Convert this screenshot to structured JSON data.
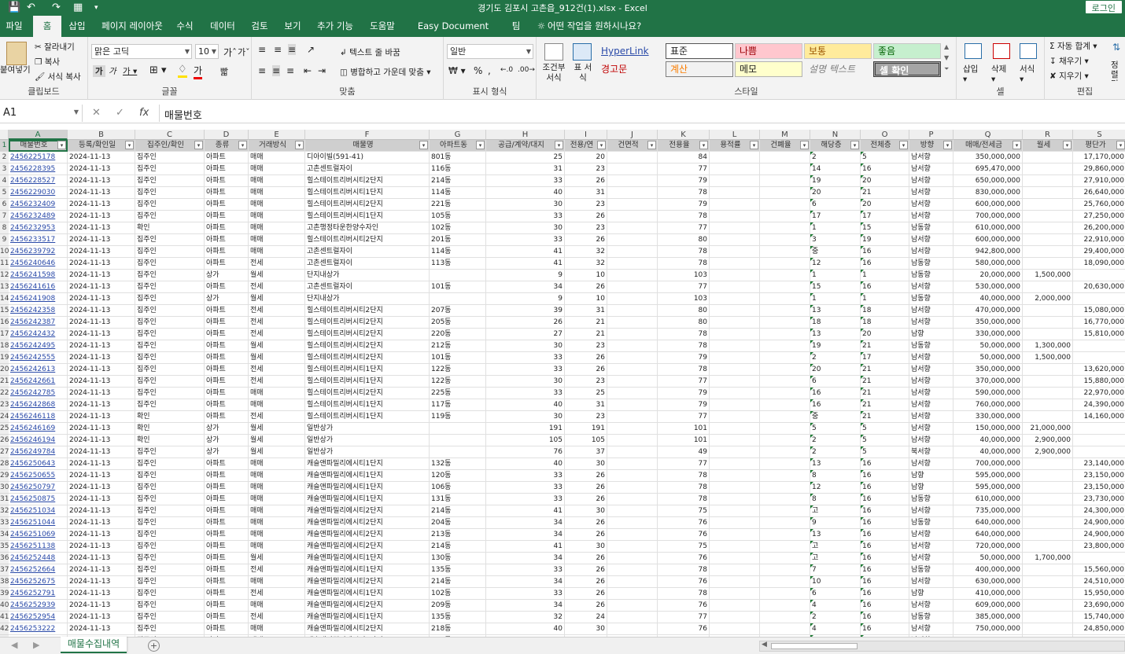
{
  "window": {
    "title": "경기도 김포시 고촌읍_912건(1).xlsx  -  Excel",
    "login": "로그인"
  },
  "tabs": [
    "파일",
    "홈",
    "삽입",
    "페이지 레이아웃",
    "수식",
    "데이터",
    "검토",
    "보기",
    "추가 기능",
    "도움말",
    "Easy Document Creator",
    "팀",
    "어떤 작업을 원하시나요?"
  ],
  "ribbon": {
    "clipboard": {
      "paste": "붙여넣기",
      "cut": "잘라내기",
      "copy": "복사",
      "format_painter": "서식 복사",
      "label": "클립보드"
    },
    "font": {
      "name": "맑은 고딕",
      "size": "10",
      "label": "글꼴"
    },
    "align": {
      "wrap": "텍스트 줄 바꿈",
      "merge": "병합하고 가운데 맞춤",
      "label": "맞춤"
    },
    "number": {
      "format": "일반",
      "label": "표시 형식"
    },
    "styles": {
      "cond": "조건부 서식",
      "table": "표 서식",
      "cells": [
        "HyperLink",
        "표준",
        "나쁨",
        "보통",
        "좋음",
        "경고문",
        "계산",
        "메모",
        "설명 텍스트",
        "셀 확인"
      ],
      "label": "스타일"
    },
    "cells": {
      "insert": "삽입",
      "delete": "삭제",
      "format": "서식",
      "label": "셀"
    },
    "edit": {
      "autosum": "자동 합계",
      "fill": "채우기",
      "clear": "지우기",
      "sort": "정렬 및 필터",
      "label": "편집"
    }
  },
  "formula": {
    "namebox": "A1",
    "content": "매물번호"
  },
  "columns": [
    "A",
    "B",
    "C",
    "D",
    "E",
    "F",
    "G",
    "H",
    "I",
    "J",
    "K",
    "L",
    "M",
    "N",
    "O",
    "P",
    "Q",
    "R",
    "S"
  ],
  "headers": [
    "매물번호",
    "등록/확인일",
    "집주인/확인",
    "종류",
    "거래방식",
    "매물명",
    "아파트동",
    "공급/계약/대지",
    "전용/연",
    "건면적",
    "전용율",
    "용적률",
    "건폐율",
    "해당층",
    "전체층",
    "방향",
    "매매/전세금",
    "월세",
    "평단가"
  ],
  "rows": [
    [
      "2456225178",
      "2024-11-13",
      "집주인",
      "아파트",
      "매매",
      "디아이빌(591-41)",
      "801동",
      "25",
      "20",
      "",
      "84",
      "",
      "",
      "2",
      "5",
      "남서향",
      "350,000,000",
      "",
      "17,170,000"
    ],
    [
      "2456228395",
      "2024-11-13",
      "집주인",
      "아파트",
      "매매",
      "고촌센트럴자이",
      "116동",
      "31",
      "23",
      "",
      "77",
      "",
      "",
      "14",
      "16",
      "남서향",
      "695,470,000",
      "",
      "29,860,000"
    ],
    [
      "2456228527",
      "2024-11-13",
      "집주인",
      "아파트",
      "매매",
      "힐스테이트리버시티2단지",
      "214동",
      "33",
      "26",
      "",
      "79",
      "",
      "",
      "19",
      "20",
      "남서향",
      "650,000,000",
      "",
      "27,910,000"
    ],
    [
      "2456229030",
      "2024-11-13",
      "집주인",
      "아파트",
      "매매",
      "힐스테이트리버시티1단지",
      "114동",
      "40",
      "31",
      "",
      "78",
      "",
      "",
      "20",
      "21",
      "남서향",
      "830,000,000",
      "",
      "26,640,000"
    ],
    [
      "2456232409",
      "2024-11-13",
      "집주인",
      "아파트",
      "매매",
      "힐스테이트리버시티2단지",
      "221동",
      "30",
      "23",
      "",
      "79",
      "",
      "",
      "6",
      "20",
      "남서향",
      "600,000,000",
      "",
      "25,760,000"
    ],
    [
      "2456232489",
      "2024-11-13",
      "집주인",
      "아파트",
      "매매",
      "힐스테이트리버시티1단지",
      "105동",
      "33",
      "26",
      "",
      "78",
      "",
      "",
      "17",
      "17",
      "남서향",
      "700,000,000",
      "",
      "27,250,000"
    ],
    [
      "2456232953",
      "2024-11-13",
      "확인",
      "아파트",
      "매매",
      "고촌행정타운한양수자인",
      "102동",
      "30",
      "23",
      "",
      "77",
      "",
      "",
      "1",
      "15",
      "남동향",
      "610,000,000",
      "",
      "26,200,000"
    ],
    [
      "2456233517",
      "2024-11-13",
      "집주인",
      "아파트",
      "매매",
      "힐스테이트리버시티2단지",
      "201동",
      "33",
      "26",
      "",
      "80",
      "",
      "",
      "3",
      "19",
      "남서향",
      "600,000,000",
      "",
      "22,910,000"
    ],
    [
      "2456239792",
      "2024-11-13",
      "집주인",
      "아파트",
      "매매",
      "고촌센트럴자이",
      "114동",
      "41",
      "32",
      "",
      "78",
      "",
      "",
      "중",
      "16",
      "남서향",
      "942,800,000",
      "",
      "29,400,000"
    ],
    [
      "2456240646",
      "2024-11-13",
      "집주인",
      "아파트",
      "전세",
      "고촌센트럴자이",
      "113동",
      "41",
      "32",
      "",
      "78",
      "",
      "",
      "12",
      "16",
      "남동향",
      "580,000,000",
      "",
      "18,090,000"
    ],
    [
      "2456241598",
      "2024-11-13",
      "집주인",
      "상가",
      "월세",
      "단지내상가",
      "",
      "9",
      "10",
      "",
      "103",
      "",
      "",
      "1",
      "1",
      "남동향",
      "20,000,000",
      "1,500,000",
      ""
    ],
    [
      "2456241616",
      "2024-11-13",
      "집주인",
      "아파트",
      "전세",
      "고촌센트럴자이",
      "101동",
      "34",
      "26",
      "",
      "77",
      "",
      "",
      "15",
      "16",
      "남서향",
      "530,000,000",
      "",
      "20,630,000"
    ],
    [
      "2456241908",
      "2024-11-13",
      "집주인",
      "상가",
      "월세",
      "단지내상가",
      "",
      "9",
      "10",
      "",
      "103",
      "",
      "",
      "1",
      "1",
      "남동향",
      "40,000,000",
      "2,000,000",
      ""
    ],
    [
      "2456242358",
      "2024-11-13",
      "집주인",
      "아파트",
      "전세",
      "힐스테이트리버시티2단지",
      "207동",
      "39",
      "31",
      "",
      "80",
      "",
      "",
      "13",
      "18",
      "남서향",
      "470,000,000",
      "",
      "15,080,000"
    ],
    [
      "2456242387",
      "2024-11-13",
      "집주인",
      "아파트",
      "전세",
      "힐스테이트리버시티2단지",
      "205동",
      "26",
      "21",
      "",
      "80",
      "",
      "",
      "18",
      "18",
      "남서향",
      "350,000,000",
      "",
      "16,770,000"
    ],
    [
      "2456242432",
      "2024-11-13",
      "집주인",
      "아파트",
      "전세",
      "힐스테이트리버시티2단지",
      "220동",
      "27",
      "21",
      "",
      "78",
      "",
      "",
      "13",
      "20",
      "남향",
      "330,000,000",
      "",
      "15,810,000"
    ],
    [
      "2456242495",
      "2024-11-13",
      "집주인",
      "아파트",
      "월세",
      "힐스테이트리버시티2단지",
      "212동",
      "30",
      "23",
      "",
      "78",
      "",
      "",
      "19",
      "21",
      "남동향",
      "50,000,000",
      "1,300,000",
      ""
    ],
    [
      "2456242555",
      "2024-11-13",
      "집주인",
      "아파트",
      "월세",
      "힐스테이트리버시티2단지",
      "101동",
      "33",
      "26",
      "",
      "79",
      "",
      "",
      "2",
      "17",
      "남서향",
      "50,000,000",
      "1,500,000",
      ""
    ],
    [
      "2456242613",
      "2024-11-13",
      "집주인",
      "아파트",
      "전세",
      "힐스테이트리버시티1단지",
      "122동",
      "33",
      "26",
      "",
      "78",
      "",
      "",
      "20",
      "21",
      "남서향",
      "350,000,000",
      "",
      "13,620,000"
    ],
    [
      "2456242661",
      "2024-11-13",
      "집주인",
      "아파트",
      "전세",
      "힐스테이트리버시티1단지",
      "122동",
      "30",
      "23",
      "",
      "77",
      "",
      "",
      "6",
      "21",
      "남서향",
      "370,000,000",
      "",
      "15,880,000"
    ],
    [
      "2456242785",
      "2024-11-13",
      "집주인",
      "아파트",
      "매매",
      "힐스테이트리버시티2단지",
      "225동",
      "33",
      "25",
      "",
      "79",
      "",
      "",
      "16",
      "21",
      "남서향",
      "590,000,000",
      "",
      "22,970,000"
    ],
    [
      "2456242868",
      "2024-11-13",
      "집주인",
      "아파트",
      "매매",
      "힐스테이트리버시티1단지",
      "117동",
      "40",
      "31",
      "",
      "79",
      "",
      "",
      "16",
      "21",
      "남서향",
      "760,000,000",
      "",
      "24,390,000"
    ],
    [
      "2456246118",
      "2024-11-13",
      "확인",
      "아파트",
      "전세",
      "힐스테이트리버시티1단지",
      "119동",
      "30",
      "23",
      "",
      "77",
      "",
      "",
      "중",
      "21",
      "남서향",
      "330,000,000",
      "",
      "14,160,000"
    ],
    [
      "2456246169",
      "2024-11-13",
      "확인",
      "상가",
      "월세",
      "일반상가",
      "",
      "191",
      "191",
      "",
      "101",
      "",
      "",
      "5",
      "5",
      "남서향",
      "150,000,000",
      "21,000,000",
      ""
    ],
    [
      "2456246194",
      "2024-11-13",
      "확인",
      "상가",
      "월세",
      "일반상가",
      "",
      "105",
      "105",
      "",
      "101",
      "",
      "",
      "2",
      "5",
      "남서향",
      "40,000,000",
      "2,900,000",
      ""
    ],
    [
      "2456249784",
      "2024-11-13",
      "집주인",
      "상가",
      "월세",
      "일반상가",
      "",
      "76",
      "37",
      "",
      "49",
      "",
      "",
      "2",
      "5",
      "북서향",
      "40,000,000",
      "2,900,000",
      ""
    ],
    [
      "2456250643",
      "2024-11-13",
      "집주인",
      "아파트",
      "매매",
      "캐슬앤파밀리에시티1단지",
      "132동",
      "40",
      "30",
      "",
      "77",
      "",
      "",
      "13",
      "16",
      "남서향",
      "700,000,000",
      "",
      "23,140,000"
    ],
    [
      "2456250655",
      "2024-11-13",
      "집주인",
      "아파트",
      "매매",
      "캐슬앤파밀리에시티1단지",
      "120동",
      "33",
      "26",
      "",
      "78",
      "",
      "",
      "8",
      "16",
      "남향",
      "595,000,000",
      "",
      "23,150,000"
    ],
    [
      "2456250797",
      "2024-11-13",
      "집주인",
      "아파트",
      "매매",
      "캐슬앤파밀리에시티1단지",
      "106동",
      "33",
      "26",
      "",
      "78",
      "",
      "",
      "12",
      "16",
      "남향",
      "595,000,000",
      "",
      "23,150,000"
    ],
    [
      "2456250875",
      "2024-11-13",
      "집주인",
      "아파트",
      "매매",
      "캐슬앤파밀리에시티1단지",
      "131동",
      "33",
      "26",
      "",
      "78",
      "",
      "",
      "8",
      "16",
      "남동향",
      "610,000,000",
      "",
      "23,730,000"
    ],
    [
      "2456251034",
      "2024-11-13",
      "집주인",
      "아파트",
      "매매",
      "캐슬앤파밀리에시티2단지",
      "214동",
      "41",
      "30",
      "",
      "75",
      "",
      "",
      "고",
      "16",
      "남서향",
      "735,000,000",
      "",
      "24,300,000"
    ],
    [
      "2456251044",
      "2024-11-13",
      "집주인",
      "아파트",
      "매매",
      "캐슬앤파밀리에시티2단지",
      "204동",
      "34",
      "26",
      "",
      "76",
      "",
      "",
      "9",
      "16",
      "남동향",
      "640,000,000",
      "",
      "24,900,000"
    ],
    [
      "2456251069",
      "2024-11-13",
      "집주인",
      "아파트",
      "매매",
      "캐슬앤파밀리에시티2단지",
      "213동",
      "34",
      "26",
      "",
      "76",
      "",
      "",
      "13",
      "16",
      "남서향",
      "640,000,000",
      "",
      "24,900,000"
    ],
    [
      "2456251138",
      "2024-11-13",
      "집주인",
      "아파트",
      "매매",
      "캐슬앤파밀리에시티2단지",
      "214동",
      "41",
      "30",
      "",
      "75",
      "",
      "",
      "고",
      "16",
      "남서향",
      "720,000,000",
      "",
      "23,800,000"
    ],
    [
      "2456252448",
      "2024-11-13",
      "집주인",
      "아파트",
      "월세",
      "캐슬앤파밀리에시티1단지",
      "130동",
      "34",
      "26",
      "",
      "76",
      "",
      "",
      "고",
      "16",
      "남서향",
      "50,000,000",
      "1,700,000",
      ""
    ],
    [
      "2456252664",
      "2024-11-13",
      "집주인",
      "아파트",
      "전세",
      "캐슬앤파밀리에시티1단지",
      "135동",
      "33",
      "26",
      "",
      "78",
      "",
      "",
      "7",
      "16",
      "남동향",
      "400,000,000",
      "",
      "15,560,000"
    ],
    [
      "2456252675",
      "2024-11-13",
      "집주인",
      "아파트",
      "매매",
      "캐슬앤파밀리에시티2단지",
      "214동",
      "34",
      "26",
      "",
      "76",
      "",
      "",
      "10",
      "16",
      "남서향",
      "630,000,000",
      "",
      "24,510,000"
    ],
    [
      "2456252791",
      "2024-11-13",
      "집주인",
      "아파트",
      "전세",
      "캐슬앤파밀리에시티1단지",
      "102동",
      "33",
      "26",
      "",
      "78",
      "",
      "",
      "6",
      "16",
      "남향",
      "410,000,000",
      "",
      "15,950,000"
    ],
    [
      "2456252939",
      "2024-11-13",
      "집주인",
      "아파트",
      "매매",
      "캐슬앤파밀리에시티2단지",
      "209동",
      "34",
      "26",
      "",
      "76",
      "",
      "",
      "4",
      "16",
      "남서향",
      "609,000,000",
      "",
      "23,690,000"
    ],
    [
      "2456252954",
      "2024-11-13",
      "집주인",
      "아파트",
      "전세",
      "캐슬앤파밀리에시티1단지",
      "135동",
      "32",
      "24",
      "",
      "77",
      "",
      "",
      "2",
      "16",
      "남동향",
      "385,000,000",
      "",
      "15,740,000"
    ],
    [
      "2456253222",
      "2024-11-13",
      "집주인",
      "아파트",
      "매매",
      "캐슬앤파밀리에시티2단지",
      "218동",
      "40",
      "30",
      "",
      "76",
      "",
      "",
      "4",
      "16",
      "남서향",
      "750,000,000",
      "",
      "24,850,000"
    ],
    [
      "2456253254",
      "2024-11-13",
      "집주인",
      "아파트",
      "매매",
      "캐슬앤파밀리에시티2단지",
      "221동",
      "33",
      "24",
      "",
      "75",
      "",
      "",
      "6",
      "16",
      "남서향",
      "590,000,000",
      "",
      "24,110,000"
    ]
  ],
  "sheet": {
    "tab": "매물수집내역"
  },
  "colors": {
    "excel_green": "#217346",
    "header_fill": "#cfcfcf",
    "link": "#2a4aa8"
  }
}
